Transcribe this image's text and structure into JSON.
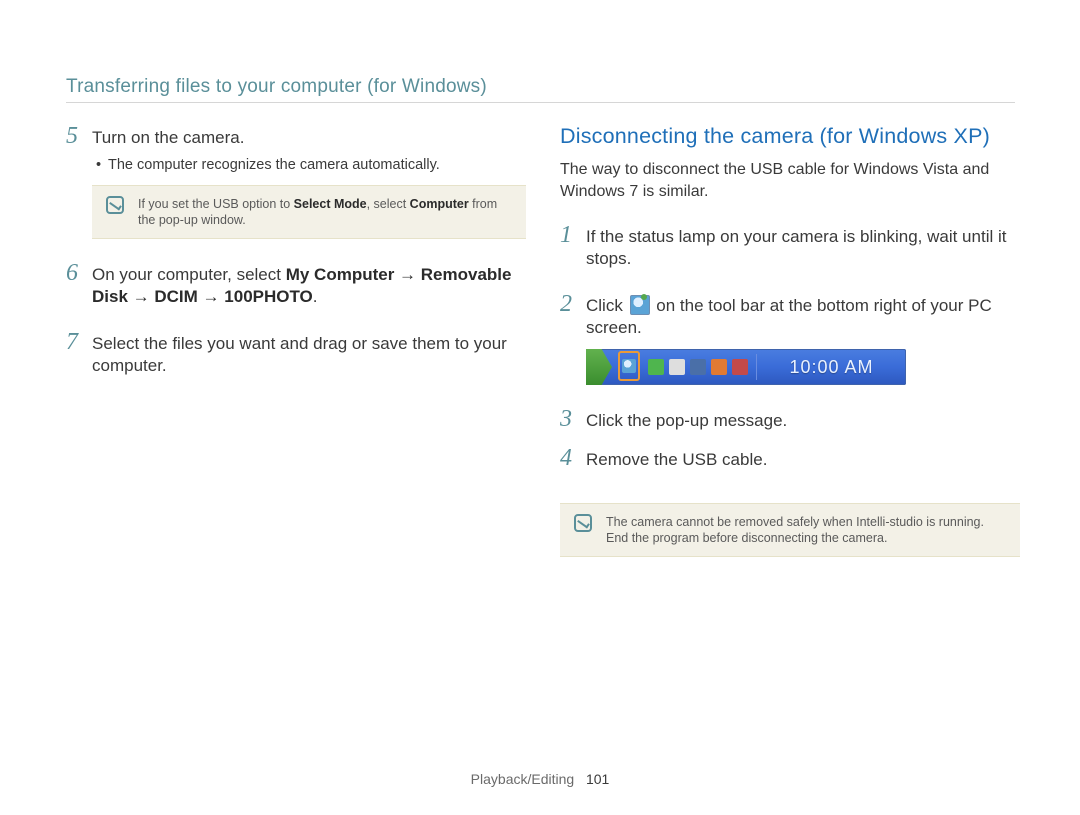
{
  "topic_title": "Transferring files to your computer (for Windows)",
  "left": {
    "step5": {
      "num": "5",
      "text": "Turn on the camera.",
      "bullet": "The computer recognizes the camera automatically.",
      "note_pre": "If you set the USB option to ",
      "note_b1": "Select Mode",
      "note_mid": ", select ",
      "note_b2": "Computer",
      "note_post": " from the pop-up window."
    },
    "step6": {
      "num": "6",
      "pre": "On your computer, select ",
      "path1": "My Computer",
      "arrow": " → ",
      "path2": "Removable Disk",
      "path3": "DCIM",
      "path4": "100PHOTO",
      "post": "."
    },
    "step7": {
      "num": "7",
      "text": "Select the files you want and drag or save them to your computer."
    }
  },
  "right": {
    "heading": "Disconnecting the camera (for Windows XP)",
    "intro": "The way to disconnect the USB cable for Windows Vista and Windows 7 is similar.",
    "step1": {
      "num": "1",
      "text": "If the status lamp on your camera is blinking, wait until it stops."
    },
    "step2": {
      "num": "2",
      "pre": "Click ",
      "post": " on the tool bar at the bottom right of your PC screen."
    },
    "tray_clock": "10:00 AM",
    "step3": {
      "num": "3",
      "text": "Click the pop-up message."
    },
    "step4": {
      "num": "4",
      "text": "Remove the USB cable."
    },
    "note": "The camera cannot be removed safely when Intelli-studio is running. End the program before disconnecting the camera."
  },
  "footer": {
    "section": "Playback/Editing",
    "page": "101"
  }
}
